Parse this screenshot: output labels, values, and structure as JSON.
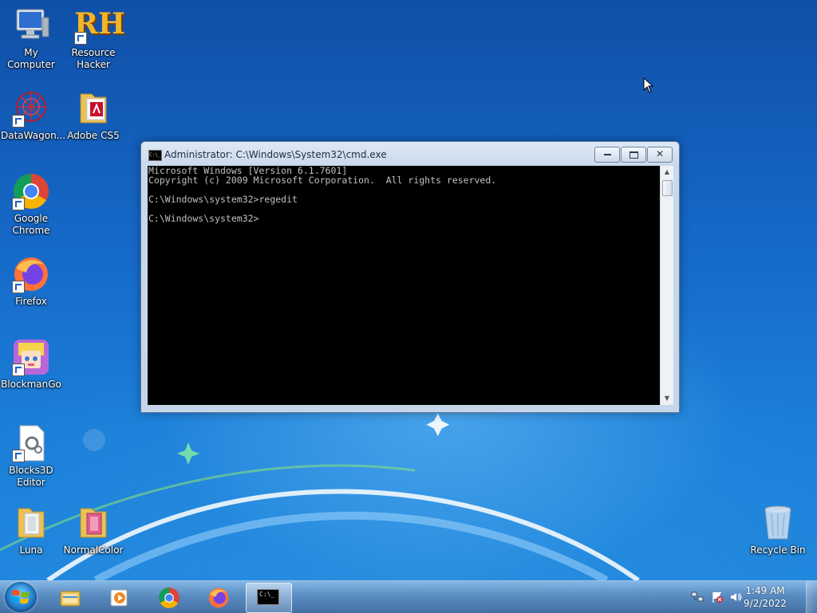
{
  "desktop": {
    "icons": [
      {
        "label": "My Computer",
        "icon": "computer-icon"
      },
      {
        "label": "Resource Hacker",
        "icon": "resource-hacker-icon",
        "logo_text": "RH"
      },
      {
        "label": "DataWagon...",
        "icon": "datawagon-icon"
      },
      {
        "label": "Adobe CS5",
        "icon": "folder-icon"
      },
      {
        "label": "Google Chrome",
        "icon": "chrome-icon"
      },
      {
        "label": "Firefox",
        "icon": "firefox-icon"
      },
      {
        "label": "BlockmanGo",
        "icon": "blockmango-icon"
      },
      {
        "label": "Blocks3D Editor",
        "icon": "blocks3d-editor-icon"
      },
      {
        "label": "Luna",
        "icon": "folder-icon"
      },
      {
        "label": "NormalColor",
        "icon": "folder-icon"
      },
      {
        "label": "Recycle Bin",
        "icon": "recycle-bin-icon"
      }
    ]
  },
  "cmd_window": {
    "title": "Administrator: C:\\Windows\\System32\\cmd.exe",
    "icon_text": "C:\\_",
    "lines": [
      "Microsoft Windows [Version 6.1.7601]",
      "Copyright (c) 2009 Microsoft Corporation.  All rights reserved.",
      "",
      "C:\\Windows\\system32>regedit",
      "",
      "C:\\Windows\\system32>"
    ]
  },
  "taskbar": {
    "buttons": [
      {
        "icon": "explorer-icon"
      },
      {
        "icon": "media-player-icon"
      },
      {
        "icon": "chrome-icon"
      },
      {
        "icon": "firefox-icon"
      },
      {
        "icon": "cmd-icon",
        "label": "C:\\_"
      }
    ],
    "clock": {
      "time": "1:49 AM",
      "date": "9/2/2022"
    }
  },
  "colors": {
    "console_bg": "#000000",
    "console_fg": "#c0c0c0"
  }
}
